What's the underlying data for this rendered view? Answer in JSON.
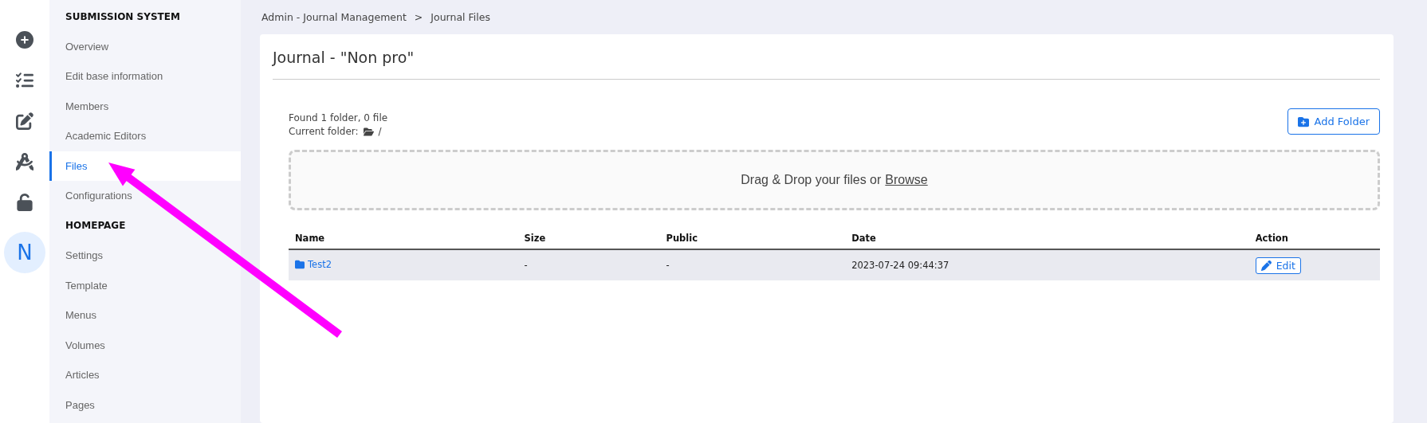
{
  "rail": {
    "icons": [
      {
        "kind": "plus"
      },
      {
        "kind": "checklist"
      },
      {
        "kind": "edit"
      },
      {
        "kind": "compass"
      },
      {
        "kind": "unlock"
      }
    ],
    "avatar": "N"
  },
  "sidebar": {
    "sections": [
      {
        "heading": "SUBMISSION SYSTEM",
        "items": [
          {
            "label": "Overview",
            "selected": false
          },
          {
            "label": "Edit base information",
            "selected": false
          },
          {
            "label": "Members",
            "selected": false
          },
          {
            "label": "Academic Editors",
            "selected": false
          },
          {
            "label": "Files",
            "selected": true
          },
          {
            "label": "Configurations",
            "selected": false
          }
        ]
      },
      {
        "heading": "HOMEPAGE",
        "items": [
          {
            "label": "Settings",
            "selected": false
          },
          {
            "label": "Template",
            "selected": false
          },
          {
            "label": "Menus",
            "selected": false
          },
          {
            "label": "Volumes",
            "selected": false
          },
          {
            "label": "Articles",
            "selected": false
          },
          {
            "label": "Pages",
            "selected": false
          }
        ]
      }
    ]
  },
  "breadcrumb": {
    "items": [
      "Admin - Journal Management",
      "Journal Files"
    ],
    "separator": ">"
  },
  "card": {
    "title": "Journal - \"Non pro\"",
    "summary": "Found 1 folder, 0 file",
    "current_folder_label": "Current folder:",
    "current_folder_path": "/",
    "add_button": "Add Folder",
    "dropzone": {
      "text": "Drag & Drop your files or",
      "link": "Browse"
    },
    "table": {
      "columns": [
        "Name",
        "Size",
        "Public",
        "Date",
        "Action"
      ],
      "rows": [
        {
          "kind": "folder",
          "name": "Test2",
          "size": "-",
          "public": "-",
          "date": "2023-07-24 09:44:37",
          "action": "Edit"
        }
      ]
    }
  }
}
